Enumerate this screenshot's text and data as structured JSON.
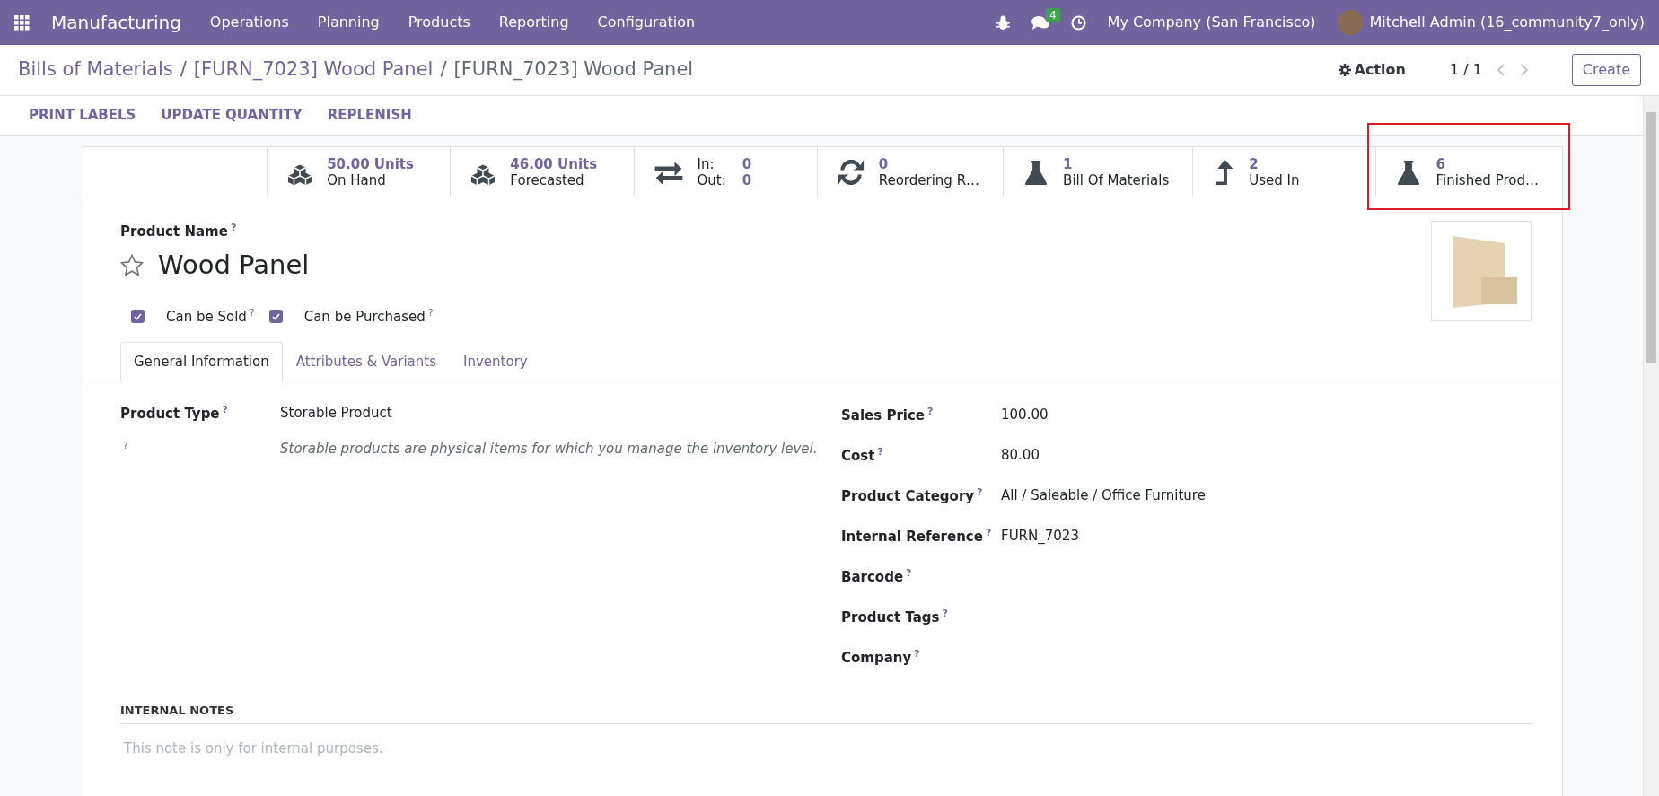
{
  "navbar": {
    "app": "Manufacturing",
    "menu": [
      "Operations",
      "Planning",
      "Products",
      "Reporting",
      "Configuration"
    ],
    "messages_badge": "4",
    "company": "My Company (San Francisco)",
    "user": "Mitchell Admin (16_community7_only)"
  },
  "breadcrumbs": [
    {
      "label": "Bills of Materials",
      "current": false
    },
    {
      "label": "[FURN_7023] Wood Panel",
      "current": false
    },
    {
      "label": "[FURN_7023] Wood Panel",
      "current": true
    }
  ],
  "breadcrumb_separator": "/",
  "action": "Action",
  "pager": "1 / 1",
  "create_button": "Create",
  "action_buttons": [
    "PRINT LABELS",
    "UPDATE QUANTITY",
    "REPLENISH"
  ],
  "smart_buttons": [
    {
      "kind": "quantity",
      "value": "50.00 Units",
      "label": "On Hand",
      "highlighted": false
    },
    {
      "kind": "quantity",
      "value": "46.00 Units",
      "label": "Forecasted",
      "highlighted": false
    },
    {
      "kind": "moves",
      "in_label": "In:",
      "in_value": "0",
      "out_label": "Out:",
      "out_value": "0",
      "highlighted": false
    },
    {
      "kind": "reordering",
      "value": "0",
      "label": "Reordering R…",
      "highlighted": false
    },
    {
      "kind": "bom",
      "value": "1",
      "label": "Bill Of Materials",
      "highlighted": false
    },
    {
      "kind": "used_in",
      "value": "2",
      "label": "Used In",
      "highlighted": false
    },
    {
      "kind": "bom",
      "value": "6",
      "label": "Finished Prod…",
      "highlighted": true
    }
  ],
  "product": {
    "name_label": "Product Name",
    "name_help": "?",
    "favorite": false,
    "name": "Wood Panel",
    "checkboxes": [
      {
        "label": "Can be Sold",
        "help": "?",
        "checked": true
      },
      {
        "label": "Can be Purchased",
        "help": "?",
        "checked": true
      }
    ]
  },
  "tabs": [
    {
      "label": "General Information",
      "selected": true
    },
    {
      "label": "Attributes & Variants",
      "selected": false
    },
    {
      "label": "Inventory",
      "selected": false
    }
  ],
  "left_fields": [
    {
      "label": "Product Type",
      "help": "?",
      "value": "Storable Product"
    }
  ],
  "description": {
    "help": "?",
    "text": "Storable products are physical items for which you manage the inventory level."
  },
  "right_fields": [
    {
      "label": "Sales Price",
      "help": "?",
      "value": "100.00"
    },
    {
      "label": "Cost",
      "help": "?",
      "value": "80.00"
    },
    {
      "label": "Product Category",
      "help": "?",
      "value": "All / Saleable / Office Furniture"
    },
    {
      "label": "Internal Reference",
      "help": "?",
      "value": "FURN_7023"
    },
    {
      "label": "Barcode",
      "help": "?"
    },
    {
      "label": "Product Tags",
      "help": "?"
    },
    {
      "label": "Company",
      "help": "?"
    }
  ],
  "notes": {
    "heading": "INTERNAL NOTES",
    "placeholder": "This note is only for internal purposes."
  }
}
